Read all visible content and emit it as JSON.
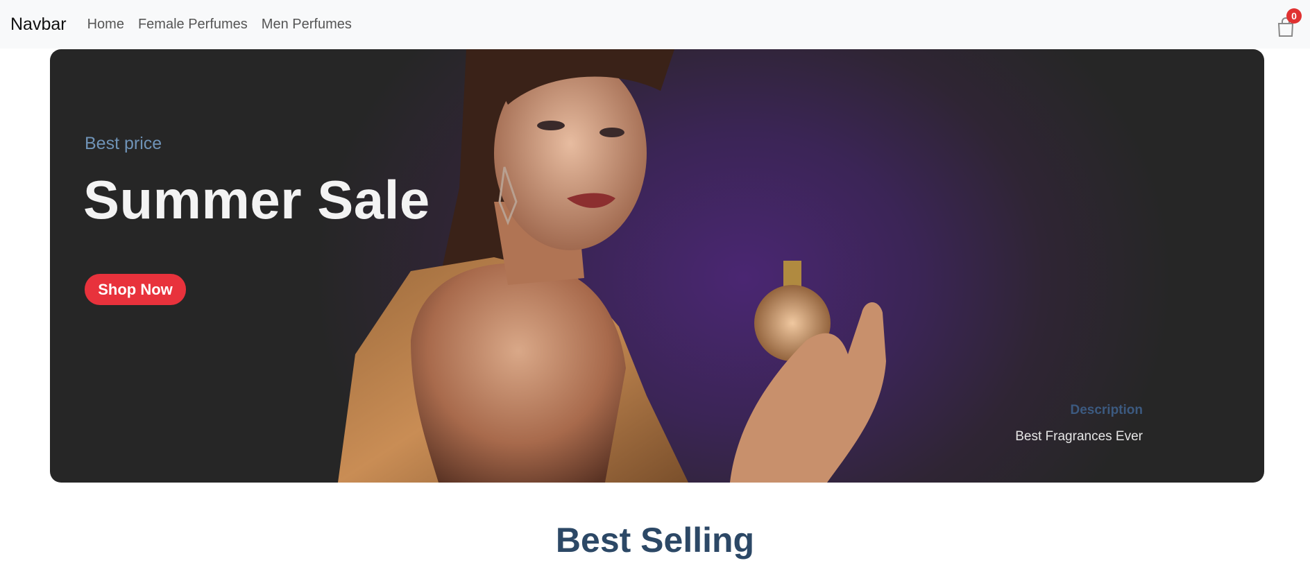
{
  "navbar": {
    "brand": "Navbar",
    "links": [
      "Home",
      "Female Perfumes",
      "Men Perfumes"
    ],
    "cart_icon": "shopping-bag-icon",
    "cart_count": "0"
  },
  "hero": {
    "kicker": "Best price",
    "title": "Summer Sale",
    "button_label": "Shop Now",
    "caption_title": "Description",
    "caption_text": "Best Fragrances Ever"
  },
  "section": {
    "title": "Best Selling"
  },
  "colors": {
    "accent": "#e8323c",
    "heading": "#2c4866",
    "navbar_bg": "#f8f9fa"
  }
}
